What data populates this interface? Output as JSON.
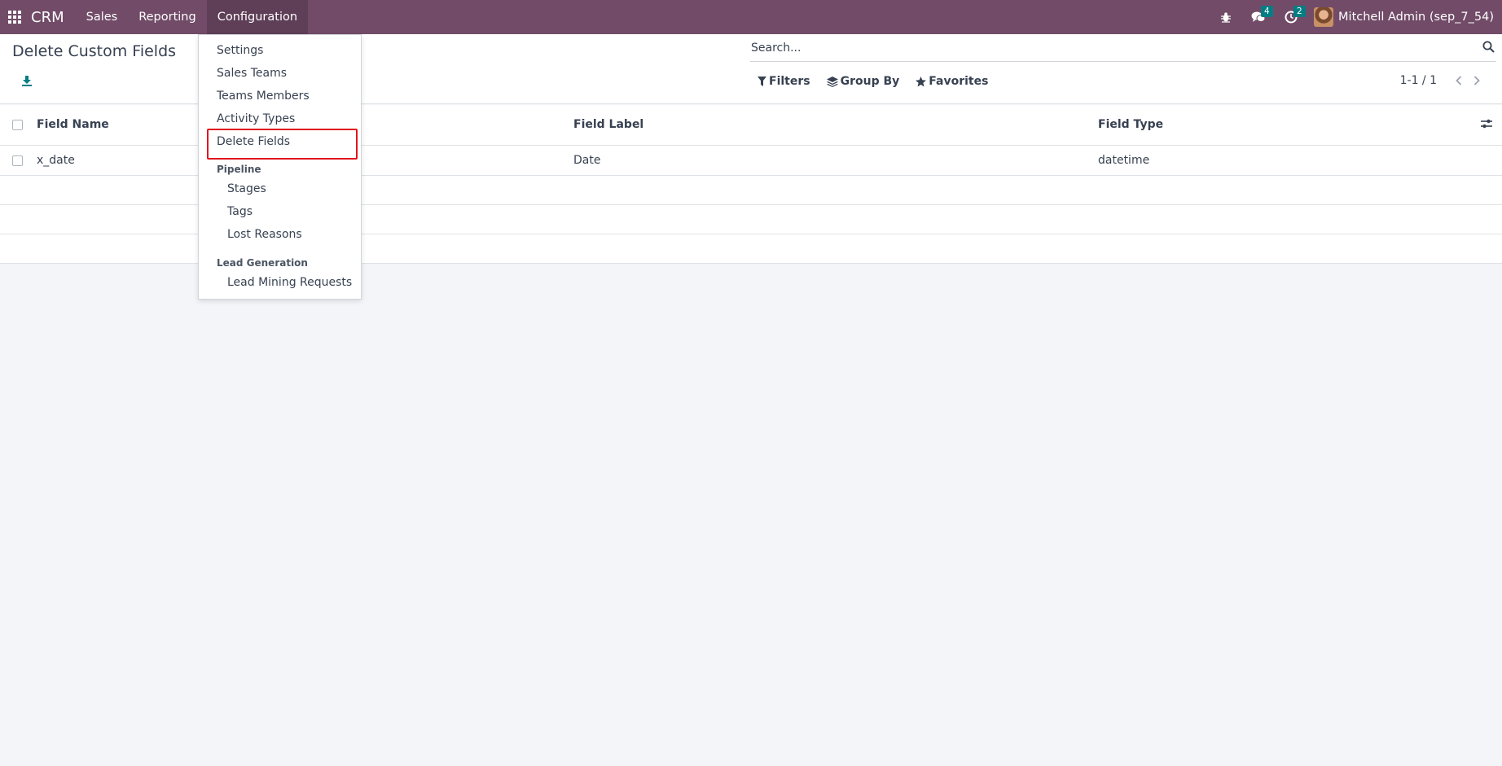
{
  "navbar": {
    "app_name": "CRM",
    "menu": [
      "Sales",
      "Reporting",
      "Configuration"
    ],
    "messages_count": "4",
    "activities_count": "2",
    "user_name": "Mitchell Admin (sep_7_54)"
  },
  "control_panel": {
    "title": "Delete Custom Fields",
    "search_placeholder": "Search...",
    "filters_label": "Filters",
    "group_by_label": "Group By",
    "favorites_label": "Favorites",
    "pager": "1-1 / 1"
  },
  "table": {
    "columns": [
      "Field Name",
      "Field Label",
      "Field Type"
    ],
    "rows": [
      {
        "field_name": "x_date",
        "field_label": "Date",
        "field_type": "datetime"
      }
    ]
  },
  "config_menu": {
    "items": [
      "Settings",
      "Sales Teams",
      "Teams Members",
      "Activity Types",
      "Delete Fields"
    ],
    "pipeline_header": "Pipeline",
    "pipeline_items": [
      "Stages",
      "Tags",
      "Lost Reasons"
    ],
    "lead_generation_header": "Lead Generation",
    "lead_generation_items": [
      "Lead Mining Requests"
    ],
    "highlighted_item": "Delete Fields"
  },
  "colors": {
    "navbar": "#714b67",
    "badge": "#017e84",
    "highlight": "#e0141e"
  }
}
